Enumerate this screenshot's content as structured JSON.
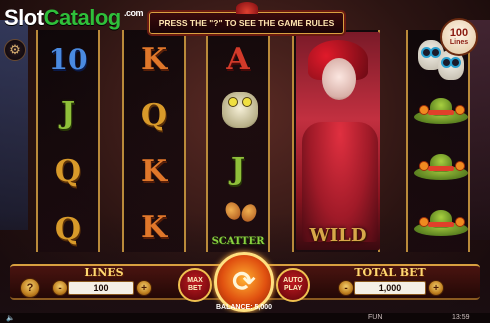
{
  "watermark": {
    "slot": "Slot",
    "catalog": "Catalog",
    "com": ".com"
  },
  "banner": {
    "text": "PRESS THE \"?\" TO SEE THE GAME RULES"
  },
  "lines_badge": {
    "number": "100",
    "label": "Lines"
  },
  "reels": [
    {
      "symbols": [
        "10",
        "J",
        "Q",
        "Q"
      ]
    },
    {
      "symbols": [
        "K",
        "Q",
        "K",
        "K"
      ]
    },
    {
      "symbols": [
        "A",
        "frog",
        "J",
        "scatter"
      ]
    },
    {
      "symbols": [
        "wild"
      ]
    },
    {
      "symbols": [
        "skull",
        "sombrero",
        "sombrero",
        "sombrero"
      ]
    }
  ],
  "symbol_labels": {
    "scatter": "SCATTER",
    "wild": "WILD"
  },
  "controls": {
    "help": "?",
    "lines_label": "LINES",
    "lines_value": "100",
    "minus": "-",
    "plus": "+",
    "max_bet": "MAX BET",
    "auto_play": "AUTO PLAY",
    "spin_icon": "spin-arrows-icon",
    "total_bet_label": "TOTAL BET",
    "total_bet_value": "1,000",
    "balance": "BALANCE: 5,000"
  },
  "status": {
    "mode": "FUN",
    "clock": "13:59"
  },
  "colors": {
    "frame": "#d8a040",
    "spin": "#e05010",
    "wild": "#c23040"
  }
}
